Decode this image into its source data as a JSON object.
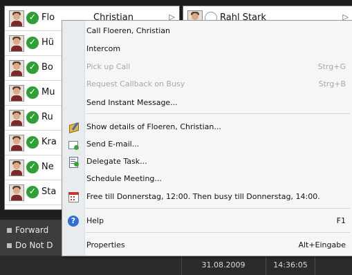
{
  "contacts_left": [
    {
      "name": "Flo",
      "extra": "Christian"
    },
    {
      "name": "Hü",
      "extra": ""
    },
    {
      "name": "Bo",
      "extra": ""
    },
    {
      "name": "Mu",
      "extra": ""
    },
    {
      "name": "Ru",
      "extra": ""
    },
    {
      "name": "Kra",
      "extra": ""
    },
    {
      "name": "Ne",
      "extra": ""
    },
    {
      "name": "Sta",
      "extra": ""
    }
  ],
  "contact_right": {
    "name": "Rahl Stark"
  },
  "bottom_bar": {
    "forward_label": "Forward",
    "dnd_label": "Do Not D"
  },
  "status_bar": {
    "date": "31.08.2009",
    "time": "14:36:05"
  },
  "context_menu": {
    "items": [
      {
        "label": "Call Floeren, Christian",
        "shortcut": "",
        "enabled": true
      },
      {
        "label": "Intercom",
        "shortcut": "",
        "enabled": true
      },
      {
        "label": "Pick up Call",
        "shortcut": "Strg+G",
        "enabled": false
      },
      {
        "label": "Request Callback on Busy",
        "shortcut": "Strg+B",
        "enabled": false
      },
      {
        "label": "Send Instant Message...",
        "shortcut": "",
        "enabled": true
      },
      {
        "label": "Show details of Floeren, Christian...",
        "shortcut": "",
        "enabled": true,
        "icon": "address-book-icon"
      },
      {
        "label": "Send E-mail...",
        "shortcut": "",
        "enabled": true,
        "icon": "email-icon"
      },
      {
        "label": "Delegate Task...",
        "shortcut": "",
        "enabled": true,
        "icon": "task-icon"
      },
      {
        "label": "Schedule Meeting...",
        "shortcut": "",
        "enabled": true
      },
      {
        "label": "Free till Donnerstag, 12:00. Then busy till Donnerstag, 14:00.",
        "shortcut": "",
        "enabled": true,
        "icon": "calendar-icon"
      },
      {
        "label": "Help",
        "shortcut": "F1",
        "enabled": true,
        "icon": "help-icon"
      },
      {
        "label": "Properties",
        "shortcut": "Alt+Eingabe",
        "enabled": true
      }
    ]
  },
  "colors": {
    "status_available": "#2f9e35",
    "menu_background": "#f5f6f7",
    "disabled_text": "#a7a7a7"
  }
}
